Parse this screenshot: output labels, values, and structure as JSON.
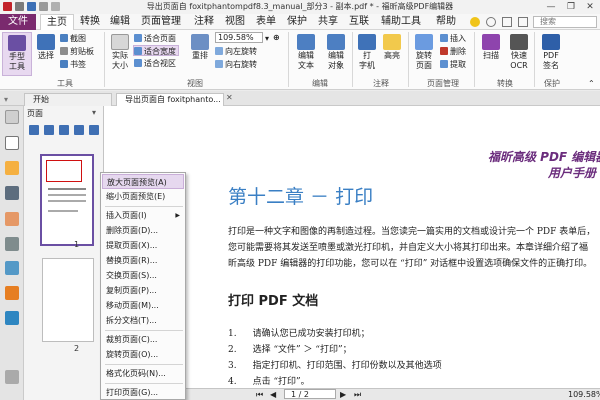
{
  "titlebar": {
    "title": "导出页面自 foxitphantompdf8.3_manual_部分3 - 副本.pdf * - 福昕高级PDF编辑器",
    "minimize": "—",
    "restore": "❐",
    "close": "✕"
  },
  "menu": {
    "file": "文件",
    "tabs": [
      "主页",
      "转换",
      "编辑",
      "页面管理",
      "注释",
      "视图",
      "表单",
      "保护",
      "共享",
      "互联",
      "辅助工具",
      "帮助"
    ],
    "search_placeholder": "搜索"
  },
  "ribbon": {
    "hand_tool": "手型\n工具",
    "select": "选择",
    "snapshot": "截图",
    "clipboard": "剪贴板",
    "bookmark": "书签",
    "actual_size": "实际\n大小",
    "fit_page": "适合页面",
    "fit_width": "适合宽度",
    "fit_visible": "适合视区",
    "reflow": "重排",
    "zoom_value": "109.58%",
    "rotate_left": "向左旋转",
    "rotate_right": "向右旋转",
    "edit_text": "编辑\n文本",
    "edit_object": "编辑\n对象",
    "typewriter": "打\n字机",
    "highlight": "高亮",
    "rotate_page": "旋转\n页面",
    "insert": "插入",
    "delete": "删除",
    "extract": "提取",
    "scan": "扫描",
    "quick_ocr": "快速\nOCR",
    "pdf_sign": "PDF\n签名",
    "groups": [
      "工具",
      "视图",
      "编辑",
      "注释",
      "页面管理",
      "转换",
      "保护"
    ]
  },
  "doc_tabs": [
    "开始",
    "导出页面自 foxitphanto..."
  ],
  "pages_panel": {
    "title": "页面",
    "thumb1_num": "1",
    "thumb2_num": "2"
  },
  "document": {
    "header_line1": "福昕高级 PDF 编辑器",
    "header_line2": "用户手册",
    "chapter": "第十二章 － 打印",
    "para1_l1": "打印是一种文字和图像的再制造过程。当您读完一篇实用的文档或设计完一个 PDF 表单后，",
    "para1_l2": "您可能需要将其发送至喷墨或激光打印机，并自定义大小将其打印出来。本章详细介绍了福",
    "para1_l3": "昕高级 PDF 编辑器的打印功能，您可以在 “打印” 对话框中设置选项确保文件的正确打印。",
    "section": "打印 PDF 文档",
    "list": [
      {
        "n": "1.",
        "t": "请确认您已成功安装打印机；"
      },
      {
        "n": "2.",
        "t": "选择 “文件” ＞ “打印”；"
      },
      {
        "n": "3.",
        "t": "指定打印机、打印范围、打印份数以及其他选项"
      },
      {
        "n": "4.",
        "t": "点击 “打印”。"
      }
    ]
  },
  "status": {
    "page": "1 / 2",
    "zoom": "109.58%"
  },
  "context_menu": [
    {
      "label": "放大页面预览(A)",
      "hl": true
    },
    {
      "label": "缩小页面预览(E)"
    },
    {
      "sep": true
    },
    {
      "label": "插入页面(I)",
      "arrow": "▶"
    },
    {
      "label": "删除页面(D)..."
    },
    {
      "label": "提取页面(X)..."
    },
    {
      "label": "替换页面(R)..."
    },
    {
      "label": "交换页面(S)..."
    },
    {
      "label": "复制页面(P)..."
    },
    {
      "label": "移动页面(M)..."
    },
    {
      "label": "拆分文档(T)..."
    },
    {
      "sep": true
    },
    {
      "label": "裁剪页面(C)..."
    },
    {
      "label": "旋转页面(O)..."
    },
    {
      "sep": true
    },
    {
      "label": "格式化页码(N)..."
    },
    {
      "sep": true
    },
    {
      "label": "打印页面(G)..."
    }
  ],
  "colors": {
    "brand": "#7a2a6e",
    "chapter": "#3a7fc4",
    "header": "#6b2d7d"
  }
}
